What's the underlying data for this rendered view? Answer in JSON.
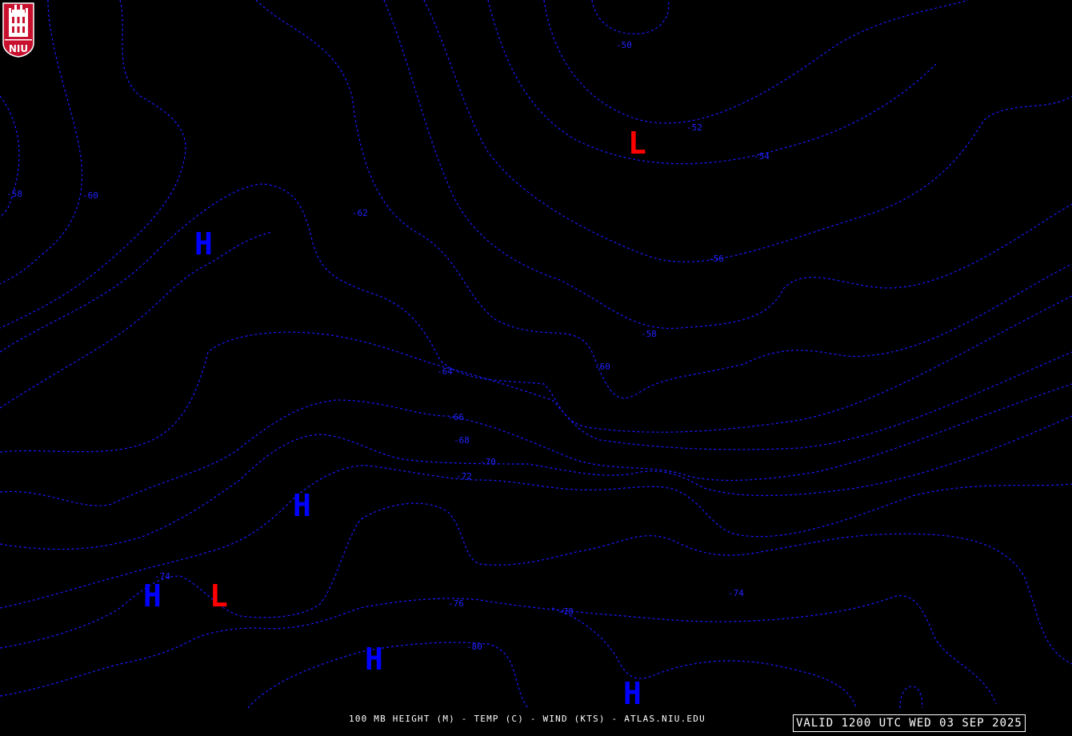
{
  "logo": {
    "text": "NIU",
    "icon": "niu-tower-logo",
    "colors": {
      "shield": "#c8102e",
      "tower": "#ffffff"
    }
  },
  "footer": {
    "caption": "100 MB HEIGHT (M) - TEMP (C) - WIND (KTS) - ATLAS.NIU.EDU"
  },
  "valid_time": "VALID 1200 UTC WED 03 SEP 2025",
  "colors": {
    "background": "#000000",
    "isotherm": "#1a1aff",
    "high": "#0000ff",
    "low": "#ff0000",
    "text": "#ffffff"
  },
  "isotherm_labels": [
    "-50",
    "-52",
    "-54",
    "-56",
    "-58",
    "-58",
    "-60",
    "-60",
    "-62",
    "-64",
    "-66",
    "-68",
    "-70",
    "-72",
    "-74",
    "-74",
    "-76",
    "-78",
    "-80"
  ],
  "pressure_centers": [
    {
      "type": "L",
      "label": "L"
    },
    {
      "type": "H",
      "label": "H"
    },
    {
      "type": "H",
      "label": "H"
    },
    {
      "type": "H",
      "label": "H"
    },
    {
      "type": "L",
      "label": "L"
    },
    {
      "type": "H",
      "label": "H"
    },
    {
      "type": "H",
      "label": "H"
    }
  ]
}
